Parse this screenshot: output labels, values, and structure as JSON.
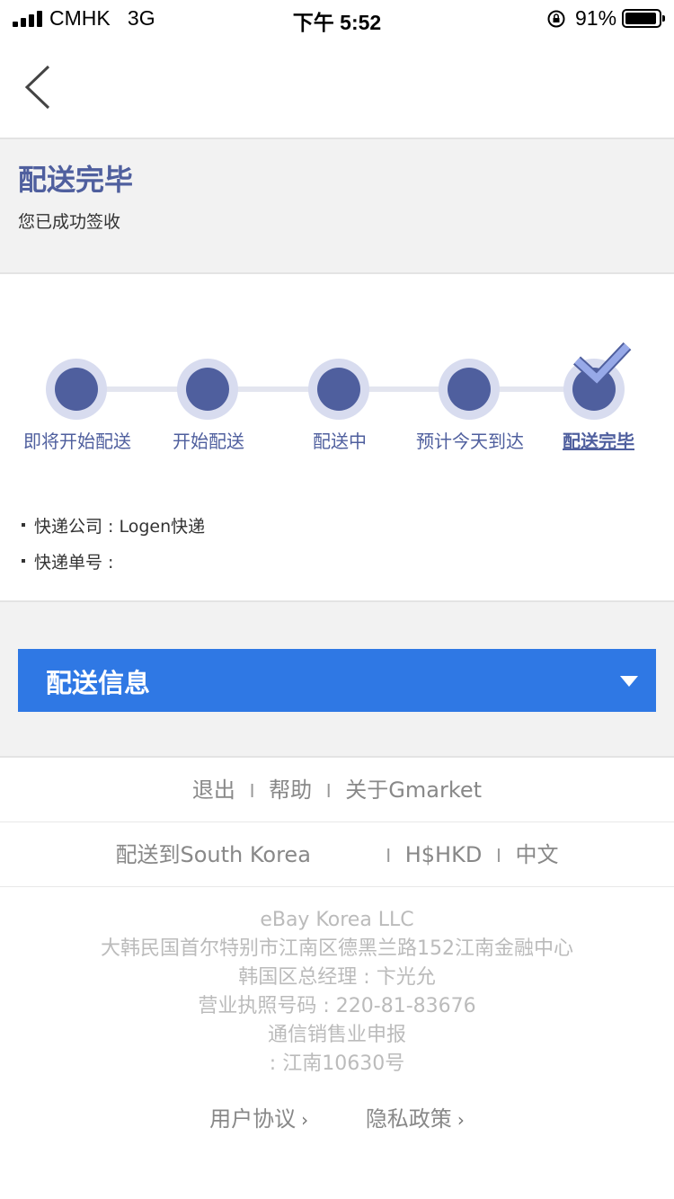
{
  "status_bar": {
    "carrier": "CMHK",
    "network": "3G",
    "time": "下午 5:52",
    "battery": "91%"
  },
  "header": {
    "title": "配送完毕",
    "subtitle": "您已成功签收"
  },
  "progress": {
    "steps": [
      {
        "label": "即将开始配送"
      },
      {
        "label": "开始配送"
      },
      {
        "label": "配送中"
      },
      {
        "label": "预计今天到达"
      },
      {
        "label": "配送完毕"
      }
    ],
    "active_index": 4
  },
  "courier": {
    "company": "快递公司 : Logen快递",
    "tracking": "快递单号 :"
  },
  "shipping_bar": {
    "label": "配送信息"
  },
  "footer": {
    "logout": "退出",
    "help": "帮助",
    "about": "关于Gmarket",
    "ship_to": "配送到South Korea",
    "currency": "H$HKD",
    "language": "中文",
    "company_lines": [
      "eBay Korea LLC",
      "大韩民国首尔特别市江南区德黑兰路152江南金融中心",
      "韩国区总经理 : 卞光允",
      "营业执照号码 : 220-81-83676",
      "通信销售业申报",
      ": 江南10630号"
    ],
    "terms": "用户协议",
    "privacy": "隐私政策"
  },
  "colors": {
    "accent": "#4f5f9e",
    "bar": "#2f78e4"
  }
}
